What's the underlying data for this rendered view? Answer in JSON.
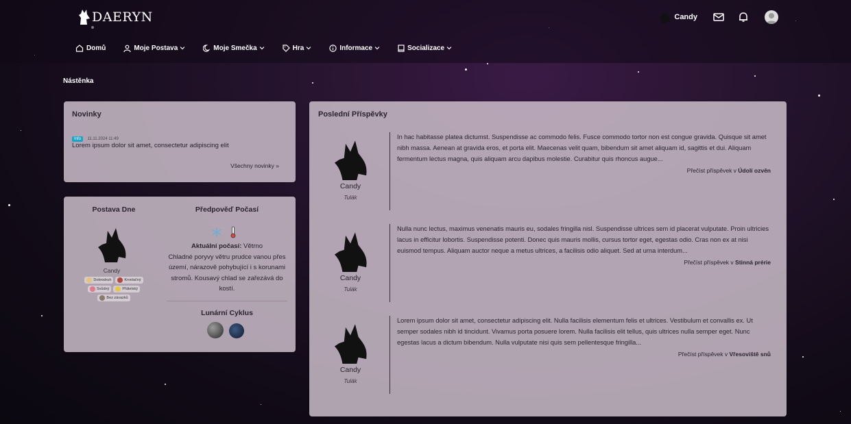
{
  "brand": {
    "name": "DAERYN"
  },
  "header": {
    "username": "Candy"
  },
  "nav": [
    {
      "label": "Domů",
      "icon": "home-icon"
    },
    {
      "label": "Moje Postava",
      "icon": "user-icon"
    },
    {
      "label": "Moje Smečka",
      "icon": "moon-icon"
    },
    {
      "label": "Hra",
      "icon": "tag-icon"
    },
    {
      "label": "Informace",
      "icon": "info-icon"
    },
    {
      "label": "Socializace",
      "icon": "book-icon"
    }
  ],
  "breadcrumb": "Nástěnka",
  "news": {
    "title": "Novinky",
    "badge": "Info",
    "date": "11.11.2024 11:49",
    "text": "Lorem ipsum dolor sit amet, consectetur adipiscing elit",
    "all_link": "Všechny novinky »"
  },
  "character_of_day": {
    "title": "Postava Dne",
    "name": "Candy",
    "traits": [
      {
        "label": "Dobrodruh",
        "color": "#e6c27a"
      },
      {
        "label": "Krvelačný",
        "color": "#b5463f"
      },
      {
        "label": "Svůdný",
        "color": "#e07a90"
      },
      {
        "label": "Přátelský",
        "color": "#e8c64a"
      },
      {
        "label": "Bez závazků",
        "color": "#8a7a6a"
      }
    ]
  },
  "weather": {
    "title": "Předpověď Počasí",
    "current_label": "Aktuální počasí:",
    "current_value": " Větrno",
    "description": "Chladné poryvy větru prudce vanou přes území, nárazově pohybující i s korunami stromů. Kousavý chlad se zařezává do kostí."
  },
  "lunar": {
    "title": "Lunární Cyklus"
  },
  "posts": {
    "title": "Poslední Příspěvky",
    "items": [
      {
        "author": "Candy",
        "role": "Tulák",
        "text": "In hac habitasse platea dictumst. Suspendisse ac commodo felis. Fusce commodo tortor non est congue gravida. Quisque sit amet nibh massa. Aenean at gravida eros, et porta elit. Maecenas velit quam, bibendum sit amet aliquam id, sagittis et dui. Aliquam fermentum lectus magna, quis aliquam arcu dapibus molestie. Curabitur quis rhoncus augue...",
        "link_prefix": "Přečíst příspěvek v ",
        "location": "Údolí ozvěn"
      },
      {
        "author": "Candy",
        "role": "Tulák",
        "text": "Nulla nunc lectus, maximus venenatis mauris eu, sodales fringilla nisl. Suspendisse ultrices sem id placerat vulputate. Proin ultricies lacus in efficitur lobortis. Suspendisse potenti. Donec quis mauris mollis, cursus tortor eget, egestas odio. Cras non ex at nisi euismod tempus. Aliquam auctor neque a metus ultrices, a facilisis odio aliquet. Sed at urna interdum...",
        "link_prefix": "Přečíst příspěvek v ",
        "location": "Stinná prérie"
      },
      {
        "author": "Candy",
        "role": "Tulák",
        "text": "Lorem ipsum dolor sit amet, consectetur adipiscing elit. Nulla facilisis elementum felis et ultrices. Vestibulum et convallis ex. Ut semper sodales nibh id tincidunt. Vivamus porta posuere lorem. Nulla facilisis elit tellus, quis ultrices nulla semper eget. Nunc egestas lacus a dictum bibendum. Nulla vulputate nisi quis sem pellentesque fringilla...",
        "link_prefix": "Přečíst příspěvek v ",
        "location": "Vřesoviště snů"
      }
    ]
  }
}
